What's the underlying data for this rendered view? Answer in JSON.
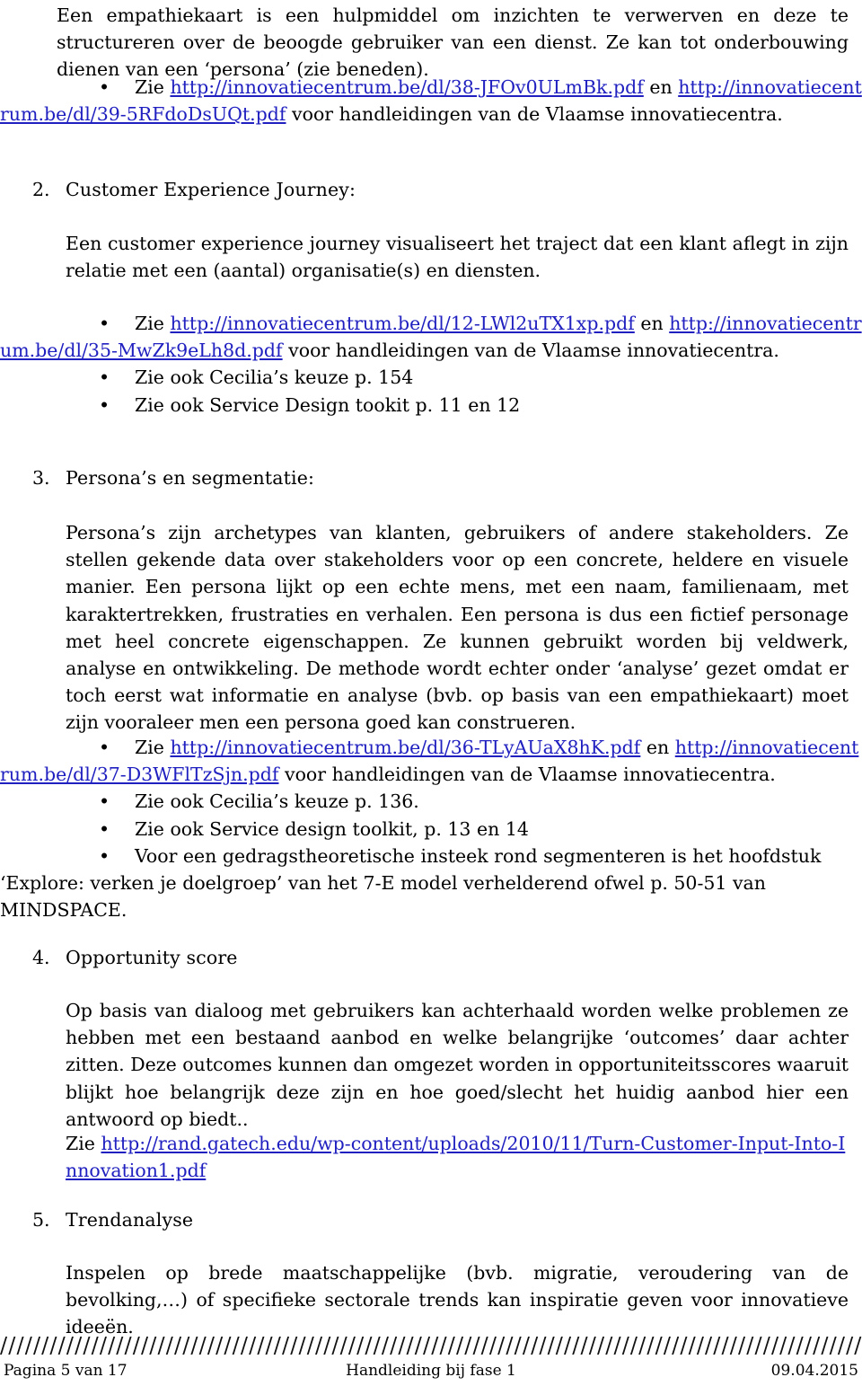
{
  "document": {
    "title": "Handleiding bij fase 1",
    "page_label": "Pagina 5 van 17",
    "date": "09.04.2015",
    "link_color": "#2020c0"
  },
  "intro": {
    "paragraph": "Een empathiekaart is een hulpmiddel om inzichten te verwerven en deze te structureren over de beoogde gebruiker van een dienst. Ze kan tot onderbouwing dienen van een ‘persona’ (zie beneden)."
  },
  "intro_bullets": [
    {
      "prefix": "Zie ",
      "link1": "http://innovatiecentrum.be/dl/38-JFOv0ULmBk.pdf",
      "middle": " en ",
      "link2": "http://innovatiecentrum.be/dl/39-5RFdoDsUQt.pdf",
      "suffix": "  voor handleidingen van de Vlaamse innovatiecentra."
    }
  ],
  "sections": [
    {
      "number": "2.",
      "heading": "Customer Experience Journey:",
      "body": "Een customer experience journey visualiseert het traject dat een klant aflegt in zijn relatie met een (aantal) organisatie(s) en diensten.",
      "bullets": [
        {
          "prefix": "Zie ",
          "link1": "http://innovatiecentrum.be/dl/12-LWl2uTX1xp.pdf",
          "middle": "  en ",
          "link2": "http://innovatiecentrum.be/dl/35-MwZk9eLh8d.pdf",
          "suffix": "  voor handleidingen van de Vlaamse innovatiecentra."
        },
        {
          "text": "Zie ook Cecilia’s keuze p. 154"
        },
        {
          "text": "Zie ook Service Design tookit p. 11 en 12"
        }
      ]
    },
    {
      "number": "3.",
      "heading": "Persona’s en segmentatie:",
      "body": "Persona’s zijn archetypes van klanten, gebruikers of andere stakeholders. Ze stellen gekende data over stakeholders voor op een concrete, heldere en visuele manier. Een persona lijkt op een echte mens, met een naam, familienaam, met karaktertrekken, frustraties en verhalen. Een persona is dus een fictief personage met heel concrete eigenschappen. Ze kunnen gebruikt worden bij veldwerk, analyse en  ontwikkeling. De methode wordt echter onder ‘analyse’ gezet omdat er toch eerst wat informatie en analyse (bvb. op basis van een empathiekaart) moet zijn vooraleer men een persona goed kan construeren.",
      "bullets": [
        {
          "prefix": "Zie ",
          "link1": "http://innovatiecentrum.be/dl/36-TLyAUaX8hK.pdf",
          "middle": " en ",
          "link2": "http://innovatiecentrum.be/dl/37-D3WFlTzSjn.pdf",
          "suffix": " voor handleidingen van de Vlaamse innovatiecentra."
        },
        {
          "text": "Zie ook Cecilia’s keuze p. 136."
        },
        {
          "text": "Zie ook Service design toolkit, p. 13 en 14"
        },
        {
          "text": "Voor een gedragstheoretische insteek rond segmenteren is het hoofdstuk ‘Explore: verken je doelgroep’ van het 7-E model  verhelderend ofwel  p. 50-51 van MINDSPACE."
        }
      ]
    },
    {
      "number": "4.",
      "heading": "Opportunity score",
      "body": "Op basis van dialoog met gebruikers kan achterhaald worden welke problemen ze hebben met een bestaand aanbod en welke belangrijke ‘outcomes’ daar achter zitten. Deze outcomes kunnen dan omgezet worden in opportuniteitsscores waaruit blijkt hoe belangrijk deze zijn en hoe goed/slecht het huidig aanbod hier een antwoord op biedt..",
      "reference": {
        "prefix": "Zie ",
        "link1": "http://rand.gatech.edu/wp-content/uploads/2010/11/Turn-Customer-Input-Into-Innovation1.pdf"
      }
    },
    {
      "number": "5.",
      "heading": "Trendanalyse",
      "body": "Inspelen op brede maatschappelijke (bvb. migratie, veroudering van de bevolking,…) of specifieke sectorale trends kan inspiratie geven voor innovatieve ideeën."
    }
  ],
  "footer": {
    "rule": "//////////////////////////////////////////////////////////////////////////////////////////////////////////////",
    "left": "Pagina 5 van 17",
    "center": "Handleiding bij fase 1",
    "right": "09.04.2015"
  }
}
